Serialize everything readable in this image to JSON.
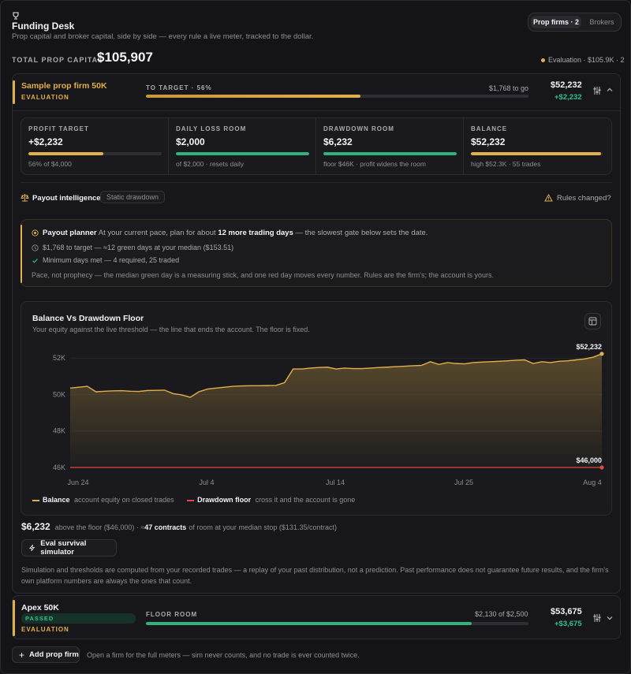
{
  "app": {
    "title": "Funding Desk",
    "subtitle": "Prop capital and broker capital, side by side — every rule a live meter, tracked to the dollar.",
    "toggle": {
      "prop": "Prop firms · 2",
      "brokers": "Brokers"
    }
  },
  "summary": {
    "label": "TOTAL PROP CAPITAL",
    "value": "$105,907",
    "status": "Evaluation · $105.9K · 2"
  },
  "firm1": {
    "name": "Sample prop firm 50K",
    "phase": "EVALUATION",
    "target_label": "TO TARGET · 56%",
    "to_go": "$1,768 to go",
    "progress": 0.56,
    "balance": "$52,232",
    "delta": "+$2,232",
    "metrics": [
      {
        "label": "PROFIT TARGET",
        "value": "+$2,232",
        "sub": "56% of $4,000",
        "fill": 0.56,
        "color": "#e2b04a"
      },
      {
        "label": "DAILY LOSS ROOM",
        "value": "$2,000",
        "sub": "of $2,000 · resets daily",
        "fill": 1.0,
        "color": "#2fb37c"
      },
      {
        "label": "DRAWDOWN ROOM",
        "value": "$6,232",
        "sub": "floor $46K · profit widens the room",
        "fill": 1.0,
        "color": "#2fb37c"
      },
      {
        "label": "BALANCE",
        "value": "$52,232",
        "sub": "high $52.3K · 55 trades",
        "fill": 0.99,
        "color": "#e2b04a"
      }
    ],
    "intel": {
      "label": "Payout intelligence",
      "tag": "Static drawdown",
      "rules": "Rules changed?"
    },
    "planner": {
      "title": "Payout planner",
      "lead_a": "At your current pace, plan for about",
      "lead_b": "12 more trading days",
      "lead_c": "— the slowest gate below sets the date.",
      "line1": "$1,768 to target — ≈12 green days at your median ($153.51)",
      "line2": "Minimum days met — 4 required, 25 traded",
      "foot": "Pace, not prophecy — the median green day is a measuring stick, and one red day moves every number. Rules are the firm's; the account is yours."
    },
    "room": {
      "value": "$6,232",
      "text_a": "above the floor ($46,000) · ≈",
      "text_b": "47 contracts",
      "text_c": "of room at your median stop ($131.35/contract)"
    },
    "sim_button": "Eval survival simulator",
    "disclaimer": "Simulation and thresholds are computed from your recorded trades — a replay of your past distribution, not a prediction. Past performance does not guarantee future results, and the firm's own platform numbers are always the ones that count."
  },
  "chart_data": {
    "type": "line",
    "title": "Balance Vs Drawdown Floor",
    "subtitle": "Your equity against the live threshold — the line that ends the account. The floor is fixed.",
    "x_ticks": [
      "Jun 24",
      "Jul 4",
      "Jul 14",
      "Jul 25",
      "Aug 4"
    ],
    "y_ticks": [
      "52K",
      "50K",
      "48K",
      "46K"
    ],
    "ylim": [
      46000,
      52700
    ],
    "series": [
      {
        "name": "Balance",
        "note": "account equity on closed trades",
        "color": "#e2b04a",
        "values": [
          50350,
          50400,
          50450,
          50150,
          50180,
          50200,
          50210,
          50180,
          50170,
          50220,
          50230,
          50240,
          50050,
          49980,
          49850,
          50150,
          50300,
          50350,
          50400,
          50450,
          50470,
          50480,
          50480,
          50490,
          50500,
          50650,
          51400,
          51400,
          51450,
          51480,
          51500,
          51400,
          51450,
          51420,
          51420,
          51450,
          51480,
          51500,
          51530,
          51550,
          51580,
          51600,
          51800,
          51650,
          51750,
          51700,
          51680,
          51750,
          51780,
          51800,
          51820,
          51850,
          51880,
          51900,
          51700,
          51800,
          51750,
          51820,
          51850,
          51900,
          51950,
          52050,
          52232
        ],
        "last_label": "$52,232"
      },
      {
        "name": "Drawdown floor",
        "note": "cross it and the account is gone",
        "color": "#e04848",
        "values": [
          46000,
          46000
        ],
        "last_label": "$46,000"
      }
    ],
    "grid": true
  },
  "firm2": {
    "name": "Apex 50K",
    "badge": "PASSED",
    "phase": "EVALUATION",
    "meter_label": "FLOOR ROOM",
    "meter_value": "$2,130 of $2,500",
    "progress": 0.852,
    "balance": "$53,675",
    "delta": "+$3,675"
  },
  "footer": {
    "add_button": "Add prop firm",
    "hint": "Open a firm for the full meters — sim never counts, and no trade is ever counted twice."
  }
}
